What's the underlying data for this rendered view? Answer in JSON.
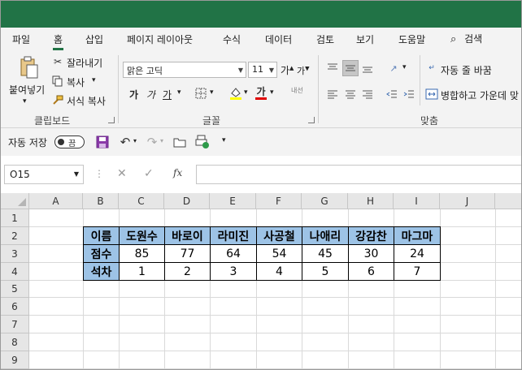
{
  "titlebar": {
    "color": "#217346"
  },
  "tabs": {
    "items": [
      "파일",
      "홈",
      "삽입",
      "페이지 레이아웃",
      "수식",
      "데이터",
      "검토",
      "보기",
      "도움말"
    ],
    "active": "홈",
    "search_label": "검색"
  },
  "ribbon": {
    "clipboard": {
      "paste_label": "붙여넣기",
      "cut_label": "잘라내기",
      "copy_label": "복사",
      "format_painter_label": "서식 복사",
      "group_label": "클립보드"
    },
    "font": {
      "font_name": "맑은 고딕",
      "font_size": "11",
      "grow_glyph": "가",
      "shrink_glyph": "가",
      "bold_glyph": "가",
      "italic_glyph": "가",
      "underline_glyph": "가",
      "font_color_glyph": "가",
      "phonetic_glyph": "내선",
      "group_label": "글꼴",
      "font_color": "#e00000",
      "fill_color": "#ffff00"
    },
    "alignment": {
      "wrap_text_label": "자동 줄 바꿈",
      "merge_center_label": "병합하고 가운데 맞",
      "group_label": "맞춤"
    }
  },
  "qat": {
    "autosave_label": "자동 저장",
    "toggle_state": "끔"
  },
  "formula_bar": {
    "name_box": "O15",
    "fx_label": "fx",
    "formula": ""
  },
  "sheet": {
    "columns": [
      "A",
      "B",
      "C",
      "D",
      "E",
      "F",
      "G",
      "H",
      "I",
      "J"
    ],
    "rows": [
      "1",
      "2",
      "3",
      "4",
      "5",
      "6",
      "7",
      "8",
      "9"
    ],
    "header_fill": "#9dc3e6",
    "table": {
      "row2": [
        "이름",
        "도원수",
        "바로이",
        "라미진",
        "사공철",
        "나애리",
        "강감찬",
        "마그마"
      ],
      "row3": [
        "점수",
        "85",
        "77",
        "64",
        "54",
        "45",
        "30",
        "24"
      ],
      "row4": [
        "석차",
        "1",
        "2",
        "3",
        "4",
        "5",
        "6",
        "7"
      ]
    }
  }
}
